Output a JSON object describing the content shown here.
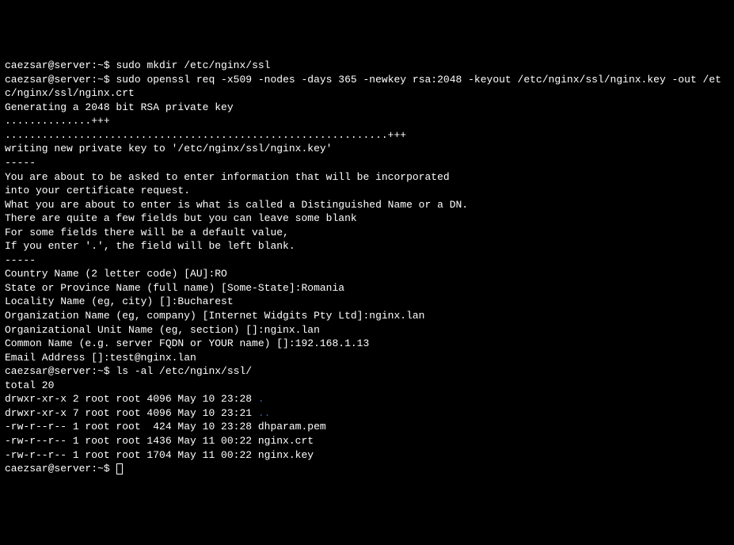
{
  "prompt1": "caezsar@server:~$ ",
  "cmd1": "sudo mkdir /etc/nginx/ssl",
  "blank1": "",
  "prompt2": "caezsar@server:~$ ",
  "cmd2": "sudo openssl req -x509 -nodes -days 365 -newkey rsa:2048 -keyout /etc/nginx/ssl/nginx.key -out /etc/nginx/ssl/nginx.crt",
  "out": {
    "l1": "Generating a 2048 bit RSA private key",
    "l2": "..............+++",
    "l3": "..............................................................+++",
    "l4": "writing new private key to '/etc/nginx/ssl/nginx.key'",
    "l5": "-----",
    "l6": "You are about to be asked to enter information that will be incorporated",
    "l7": "into your certificate request.",
    "l8": "What you are about to enter is what is called a Distinguished Name or a DN.",
    "l9": "There are quite a few fields but you can leave some blank",
    "l10": "For some fields there will be a default value,",
    "l11": "If you enter '.', the field will be left blank.",
    "l12": "-----",
    "l13": "Country Name (2 letter code) [AU]:RO",
    "l14": "State or Province Name (full name) [Some-State]:Romania",
    "l15": "Locality Name (eg, city) []:Bucharest",
    "l16": "Organization Name (eg, company) [Internet Widgits Pty Ltd]:nginx.lan",
    "l17": "Organizational Unit Name (eg, section) []:nginx.lan",
    "l18": "Common Name (e.g. server FQDN or YOUR name) []:192.168.1.13",
    "l19": "Email Address []:test@nginx.lan"
  },
  "prompt3": "caezsar@server:~$ ",
  "cmd3": "ls -al /etc/nginx/ssl/",
  "ls": {
    "total": "total 20",
    "r1a": "drwxr-xr-x 2 root root 4096 May 10 23:28 ",
    "r1b": ".",
    "r2a": "drwxr-xr-x 7 root root 4096 May 10 23:21 ",
    "r2b": "..",
    "r3": "-rw-r--r-- 1 root root  424 May 10 23:28 dhparam.pem",
    "r4": "-rw-r--r-- 1 root root 1436 May 11 00:22 nginx.crt",
    "r5": "-rw-r--r-- 1 root root 1704 May 11 00:22 nginx.key"
  },
  "prompt4": "caezsar@server:~$ "
}
